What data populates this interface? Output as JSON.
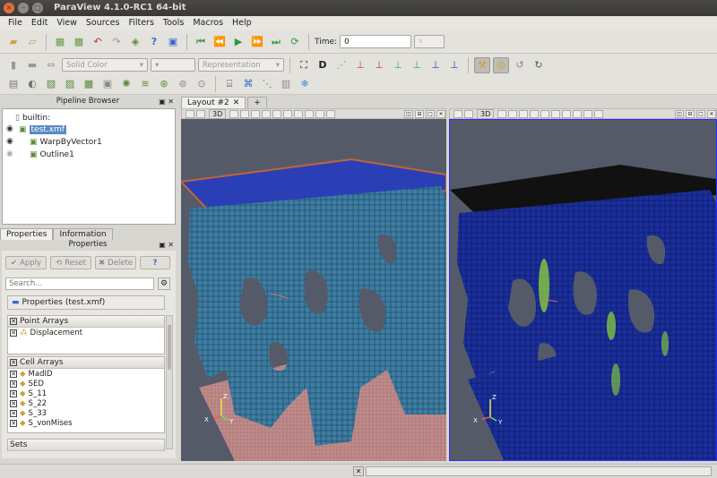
{
  "window": {
    "title": "ParaView 4.1.0-RC1 64-bit"
  },
  "menu": [
    "File",
    "Edit",
    "View",
    "Sources",
    "Filters",
    "Tools",
    "Macros",
    "Help"
  ],
  "toolbar": {
    "time_label": "Time:",
    "time_value": "0",
    "color_mode": "Solid Color",
    "representation": "Representation"
  },
  "pipeline": {
    "title": "Pipeline Browser",
    "root": "builtin:",
    "items": [
      "test.xmf",
      "WarpByVector1",
      "Outline1"
    ]
  },
  "tabs": [
    "Properties",
    "Information"
  ],
  "properties": {
    "title": "Properties",
    "apply": "Apply",
    "reset": "Reset",
    "delete": "Delete",
    "help": "?",
    "search_placeholder": "Search...",
    "section_label": "Properties (test.xmf)",
    "point_arrays_label": "Point Arrays",
    "point_arrays": [
      "Displacement"
    ],
    "cell_arrays_label": "Cell Arrays",
    "cell_arrays": [
      "MadID",
      "SED",
      "S_11",
      "S_22",
      "S_33",
      "S_vonMises"
    ],
    "sets_label": "Sets"
  },
  "layout": {
    "tab_label": "Layout #2",
    "view_3d_label": "3D"
  },
  "axes": {
    "x": "X",
    "y": "Y",
    "z": "Z"
  },
  "colors": {
    "background": "#555a69",
    "structure_left": "#3d7ea3",
    "structure_right": "#1a2f9e",
    "highlight": "#8fd835"
  }
}
